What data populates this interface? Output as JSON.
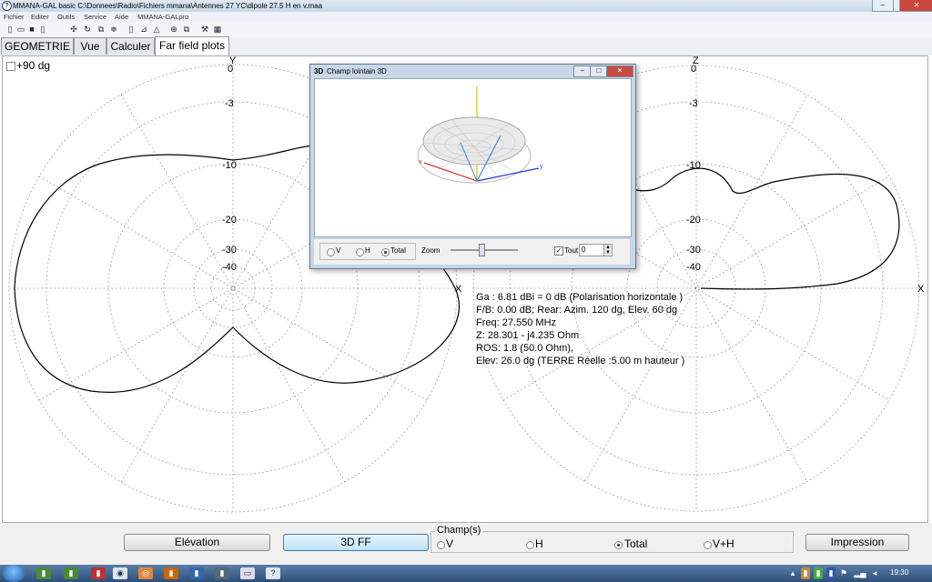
{
  "window": {
    "title": "MMANA-GAL basic C:\\Donnees\\Radio\\Fichiers mmana\\Antennes 27 YC\\dipole 27.5 H en v.maa",
    "min": "–",
    "max": "□",
    "close": "✕"
  },
  "menu": [
    "Fichier",
    "Editer",
    "Outils",
    "Service",
    "Aide",
    "MMANA-GALpro"
  ],
  "toolbar_icons": [
    "new-icon",
    "open-icon",
    "save-icon",
    "info-icon",
    "move-icon",
    "rotate-icon",
    "copy-icon",
    "split-icon",
    "page-icon",
    "chart-icon",
    "triangle-icon",
    "target-icon",
    "duplicate-icon",
    "tools-icon",
    "table-icon"
  ],
  "tabs": [
    {
      "label": "GEOMETRIE",
      "active": false
    },
    {
      "label": "Vue",
      "active": false
    },
    {
      "label": "Calculer",
      "active": false
    },
    {
      "label": "Far field plots",
      "active": true
    }
  ],
  "plot": {
    "checkbox_label": "+90 dg",
    "left_axis_top": "Y",
    "left_axis_right": "X",
    "right_axis_top": "Z",
    "right_axis_right": "X",
    "db_labels": [
      "0",
      "-3",
      "-10",
      "-20",
      "-30",
      "-40"
    ]
  },
  "info": {
    "line1": "Ga : 6.81 dBi = 0 dB  (Polarisation horizontale )",
    "line2": "F/B: 0.00 dB; Rear: Azim. 120 dg, Elev. 60 dg",
    "line3": "Freq: 27.550 MHz",
    "line4": "Z: 28.301 - j4.235 Ohm",
    "line5": "ROS: 1.8 (50.0 Ohm),",
    "line6": "Elev: 26.0 dg (TERRE Réelle    :5.00 m hauteur )"
  },
  "window3d": {
    "title": "Champ lointain 3D",
    "badge": "3D",
    "axis_x": "x",
    "axis_y": "y",
    "radio_v": "V",
    "radio_h": "H",
    "radio_total": "Total",
    "zoom_label": "Zoom",
    "zoom_level": 0.3,
    "tout_label": "Tout",
    "tout_checked": true,
    "spin_value": "0"
  },
  "bottom": {
    "elevation": "Elévation",
    "ff3d": "3D FF",
    "impression": "Impression",
    "champs": "Champ(s)",
    "opt_v": "V",
    "opt_h": "H",
    "opt_total": "Total",
    "opt_vh": "V+H",
    "selected": "Total"
  },
  "taskbar": {
    "clock": "19:30"
  },
  "colors": {
    "plot_line": "#000000",
    "grid": "#888888",
    "selected_button": "#bfe3f6",
    "taskbar": "#2d4f7a"
  }
}
